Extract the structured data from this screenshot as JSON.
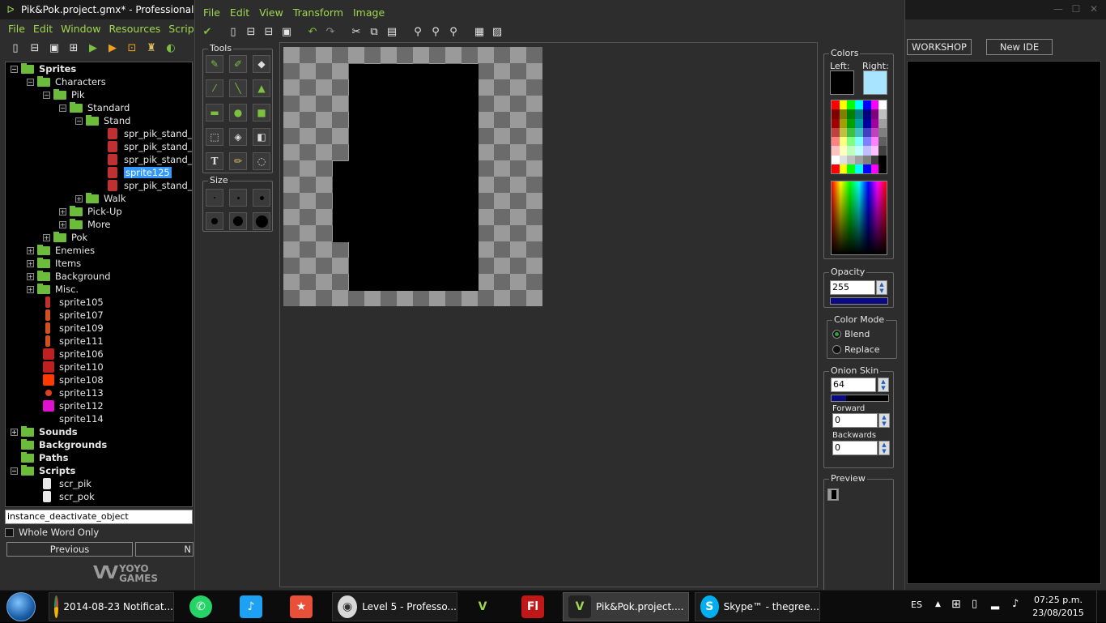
{
  "main_window": {
    "title": "Pik&Pok.project.gmx*  -  Professional Ed",
    "menu": [
      "File",
      "Edit",
      "Window",
      "Resources",
      "Scripts"
    ],
    "workshop_label": "WORKSHOP",
    "new_ide_label": "New IDE"
  },
  "tree": {
    "sprites": "Sprites",
    "characters": "Characters",
    "pik": "Pik",
    "standard": "Standard",
    "stand": "Stand",
    "stand_items": [
      "spr_pik_stand_dov",
      "spr_pik_stand_up",
      "spr_pik_stand_left",
      "sprite125",
      "spr_pik_stand_righ"
    ],
    "walk": "Walk",
    "pickup": "Pick-Up",
    "more": "More",
    "pok": "Pok",
    "enemies": "Enemies",
    "items": "Items",
    "background": "Background",
    "misc": "Misc.",
    "loose_sprites": [
      "sprite105",
      "sprite107",
      "sprite109",
      "sprite111",
      "sprite106",
      "sprite110",
      "sprite108",
      "sprite113",
      "sprite112",
      "sprite114"
    ],
    "sounds": "Sounds",
    "backgrounds": "Backgrounds",
    "paths": "Paths",
    "scripts": "Scripts",
    "script_items": [
      "scr_pik",
      "scr_pok"
    ]
  },
  "search": {
    "value": "instance_deactivate_object",
    "whole_word_label": "Whole Word Only",
    "previous_label": "Previous",
    "next_label": "N"
  },
  "logo": {
    "line1": "YOYO",
    "line2": "GAMES"
  },
  "editor": {
    "menu": [
      "File",
      "Edit",
      "View",
      "Transform",
      "Image"
    ],
    "tools_title": "Tools",
    "size_title": "Size",
    "colors": {
      "title": "Colors",
      "left_label": "Left:",
      "right_label": "Right:",
      "left_color": "#000000",
      "right_color": "#a8e4ff"
    },
    "opacity": {
      "title": "Opacity",
      "value": "255",
      "level": 1.0
    },
    "color_mode": {
      "title": "Color Mode",
      "blend": "Blend",
      "replace": "Replace",
      "selected": "Blend"
    },
    "onion_skin": {
      "title": "Onion Skin",
      "value": "64",
      "level": 0.25,
      "forward_label": "Forward",
      "forward_value": "0",
      "backwards_label": "Backwards",
      "backwards_value": "0"
    },
    "preview_title": "Preview"
  },
  "taskbar": {
    "apps": [
      {
        "name": "chrome",
        "label": "2014-08-23  Notificat..."
      },
      {
        "name": "whatsapp",
        "label": ""
      },
      {
        "name": "twitter",
        "label": ""
      },
      {
        "name": "tasks",
        "label": ""
      },
      {
        "name": "professor",
        "label": "Level 5 - Professo..."
      },
      {
        "name": "gamemaker",
        "label": ""
      },
      {
        "name": "flash",
        "label": "Fl"
      },
      {
        "name": "gamemaker-project",
        "label": "Pik&Pok.project...."
      },
      {
        "name": "skype",
        "label": "Skype™ - thegree..."
      }
    ],
    "language": "ES",
    "time": "07:25 p.m.",
    "date": "23/08/2015"
  }
}
